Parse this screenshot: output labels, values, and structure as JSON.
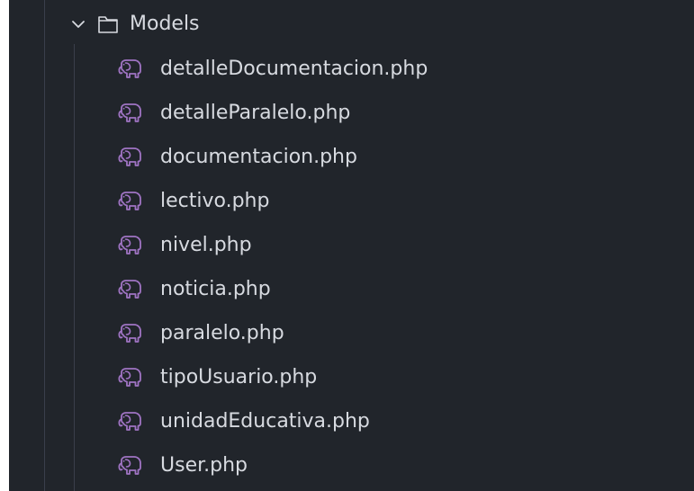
{
  "explorer": {
    "folder": {
      "label": "Models",
      "expanded": true,
      "icon": "folder-icon"
    },
    "files": [
      {
        "label": "detalleDocumentacion.php",
        "icon": "php-elephant-icon"
      },
      {
        "label": "detalleParalelo.php",
        "icon": "php-elephant-icon"
      },
      {
        "label": "documentacion.php",
        "icon": "php-elephant-icon"
      },
      {
        "label": "lectivo.php",
        "icon": "php-elephant-icon"
      },
      {
        "label": "nivel.php",
        "icon": "php-elephant-icon"
      },
      {
        "label": "noticia.php",
        "icon": "php-elephant-icon"
      },
      {
        "label": "paralelo.php",
        "icon": "php-elephant-icon"
      },
      {
        "label": "tipoUsuario.php",
        "icon": "php-elephant-icon"
      },
      {
        "label": "unidadEducativa.php",
        "icon": "php-elephant-icon"
      },
      {
        "label": "User.php",
        "icon": "php-elephant-icon"
      }
    ]
  },
  "colors": {
    "background": "#21252b",
    "text": "#d7dae0",
    "php_icon": "#a074c4",
    "guide": "#3a3f4b"
  }
}
